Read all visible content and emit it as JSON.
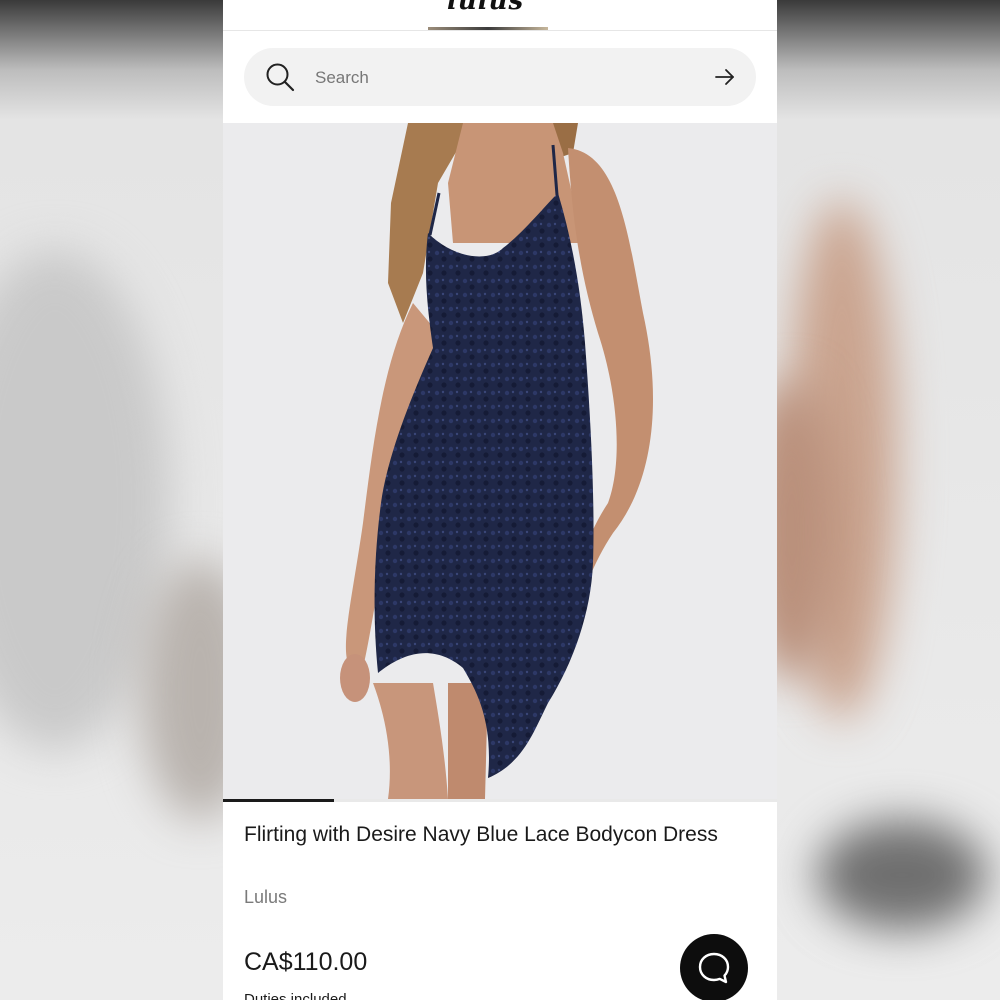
{
  "header": {
    "logo_text": "lulus"
  },
  "search": {
    "placeholder": "Search"
  },
  "product": {
    "title": "Flirting with Desire Navy Blue Lace Bodycon Dress",
    "brand": "Lulus",
    "price": "CA$110.00",
    "tax_note": "Duties included",
    "image_carousel_progress": 0.2,
    "dress_color": "#1f2747"
  },
  "chat": {
    "icon": "chat-bubble-icon"
  }
}
